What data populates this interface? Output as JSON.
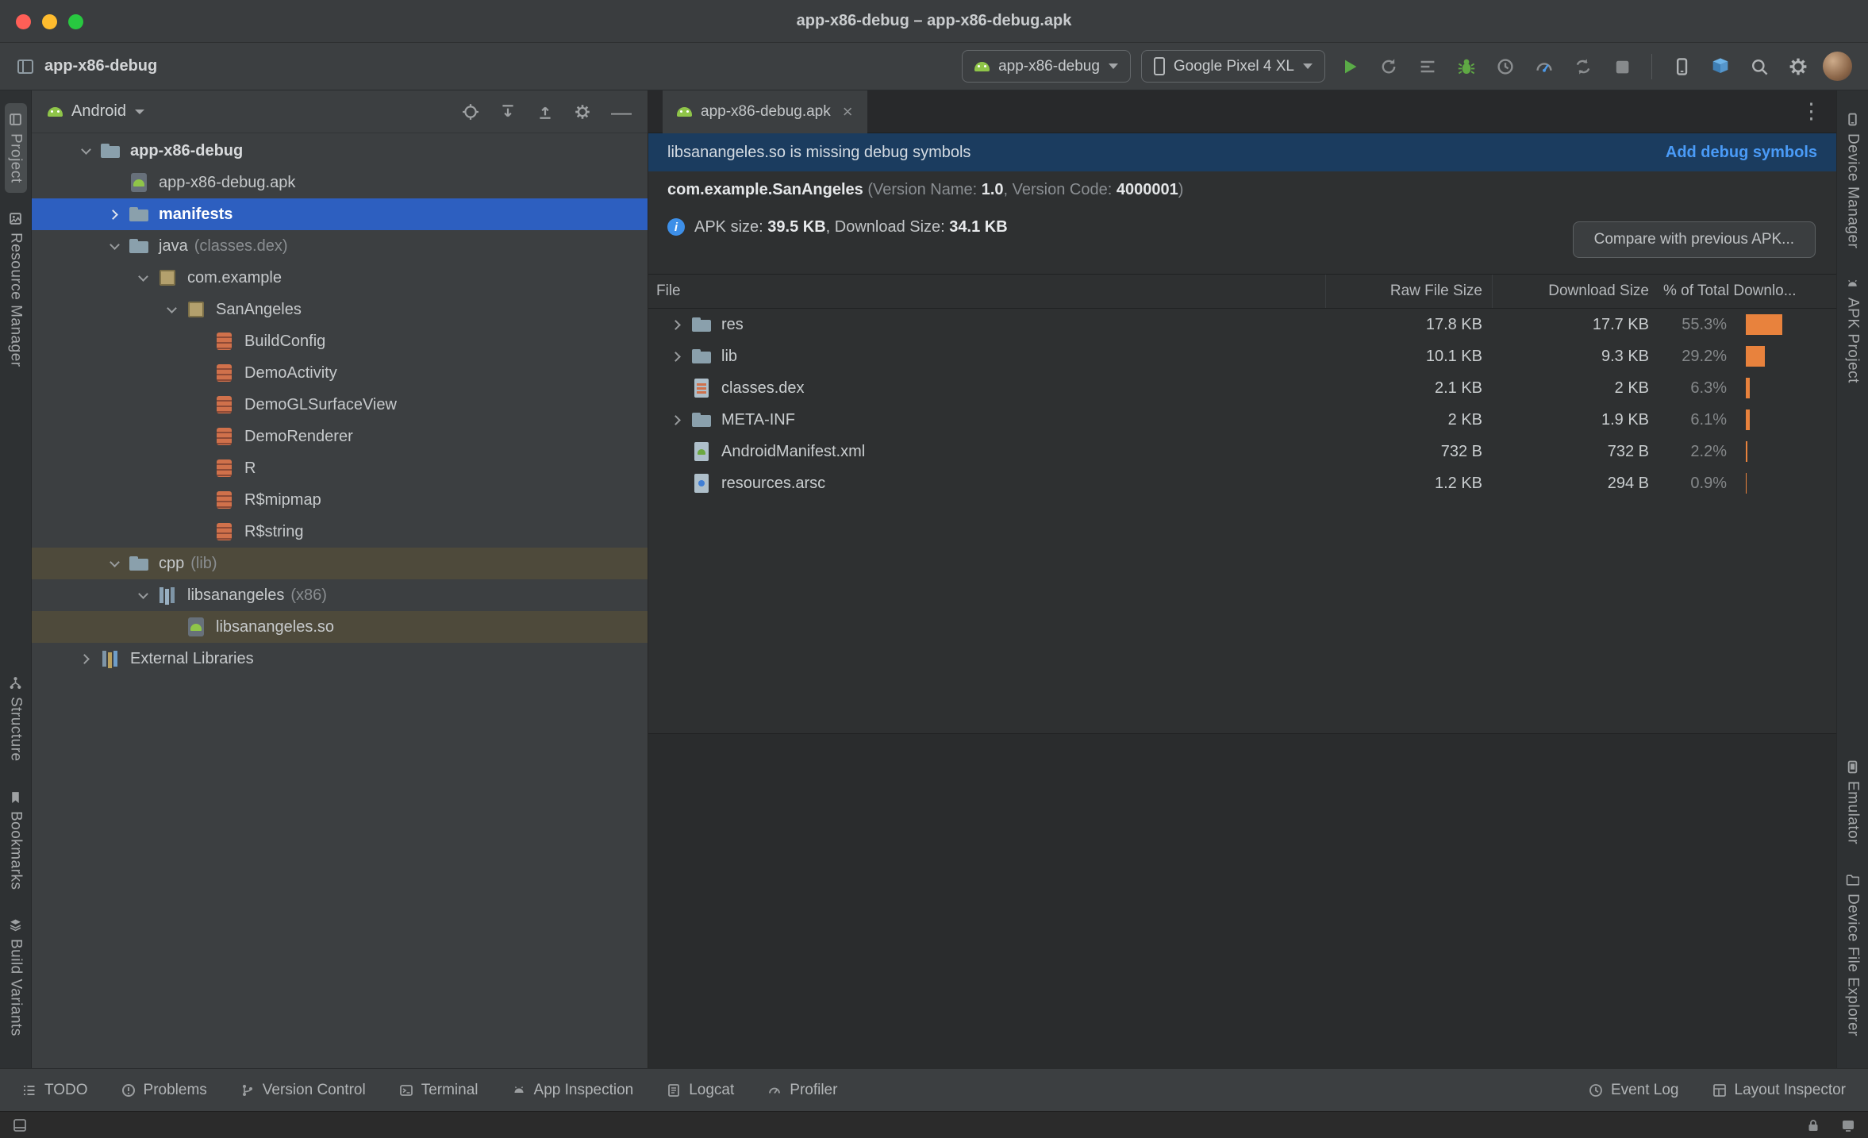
{
  "colors": {
    "selection_blue": "#2d5fc0",
    "tree_highlight_brown": "#4e4a3b",
    "bar_orange": "#e8823d",
    "link_blue": "#4a9bf7",
    "run_green": "#5aab47",
    "banner_blue": "#1b3c5f"
  },
  "window": {
    "title": "app-x86-debug – app-x86-debug.apk",
    "project_name": "app-x86-debug"
  },
  "toolbar": {
    "run_config": "app-x86-debug",
    "device": "Google Pixel 4 XL"
  },
  "left_stripe": {
    "items": [
      {
        "label": "Project"
      },
      {
        "label": "Resource Manager"
      },
      {
        "label": "Structure"
      },
      {
        "label": "Bookmarks"
      },
      {
        "label": "Build Variants"
      }
    ]
  },
  "right_stripe": {
    "items": [
      {
        "label": "Device Manager"
      },
      {
        "label": "APK Project"
      },
      {
        "label": "Emulator"
      },
      {
        "label": "Device File Explorer"
      }
    ]
  },
  "project_panel": {
    "view_selector": "Android",
    "tree": [
      {
        "label": "app-x86-debug",
        "annotation": ""
      },
      {
        "label": "app-x86-debug.apk",
        "annotation": ""
      },
      {
        "label": "manifests",
        "annotation": ""
      },
      {
        "label": "java",
        "annotation": "(classes.dex)"
      },
      {
        "label": "com.example",
        "annotation": ""
      },
      {
        "label": "SanAngeles",
        "annotation": ""
      },
      {
        "label": "BuildConfig",
        "annotation": ""
      },
      {
        "label": "DemoActivity",
        "annotation": ""
      },
      {
        "label": "DemoGLSurfaceView",
        "annotation": ""
      },
      {
        "label": "DemoRenderer",
        "annotation": ""
      },
      {
        "label": "R",
        "annotation": ""
      },
      {
        "label": "R$mipmap",
        "annotation": ""
      },
      {
        "label": "R$string",
        "annotation": ""
      },
      {
        "label": "cpp",
        "annotation": "(lib)"
      },
      {
        "label": "libsanangeles",
        "annotation": "(x86)"
      },
      {
        "label": "libsanangeles.so",
        "annotation": ""
      },
      {
        "label": "External Libraries",
        "annotation": ""
      }
    ]
  },
  "editor": {
    "tab_title": "app-x86-debug.apk",
    "banner": {
      "message": "libsanangeles.so is missing debug symbols",
      "action": "Add debug symbols"
    },
    "package_line": {
      "name": "com.example.SanAngeles",
      "version_name_label": " (Version Name: ",
      "version_name": "1.0",
      "version_code_label": ", Version Code: ",
      "version_code": "4000001",
      "closing": ")"
    },
    "size_line": {
      "apk_label": "APK size: ",
      "apk_size": "39.5 KB",
      "download_label": ", Download Size: ",
      "download_size": "34.1 KB"
    },
    "compare_button": "Compare with previous APK...",
    "table": {
      "columns": {
        "file": "File",
        "raw": "Raw File Size",
        "download": "Download Size",
        "pct": "% of Total Downlo..."
      },
      "rows": [
        {
          "file": "res",
          "raw": "17.8 KB",
          "download": "17.7 KB",
          "pct": "55.3%",
          "pct_value": 55.3
        },
        {
          "file": "lib",
          "raw": "10.1 KB",
          "download": "9.3 KB",
          "pct": "29.2%",
          "pct_value": 29.2
        },
        {
          "file": "classes.dex",
          "raw": "2.1 KB",
          "download": "2 KB",
          "pct": "6.3%",
          "pct_value": 6.3
        },
        {
          "file": "META-INF",
          "raw": "2 KB",
          "download": "1.9 KB",
          "pct": "6.1%",
          "pct_value": 6.1
        },
        {
          "file": "AndroidManifest.xml",
          "raw": "732 B",
          "download": "732 B",
          "pct": "2.2%",
          "pct_value": 2.2
        },
        {
          "file": "resources.arsc",
          "raw": "1.2 KB",
          "download": "294 B",
          "pct": "0.9%",
          "pct_value": 0.9
        }
      ]
    }
  },
  "status_bar": {
    "left": [
      {
        "label": "TODO"
      },
      {
        "label": "Problems"
      },
      {
        "label": "Version Control"
      },
      {
        "label": "Terminal"
      },
      {
        "label": "App Inspection"
      },
      {
        "label": "Logcat"
      },
      {
        "label": "Profiler"
      }
    ],
    "right": [
      {
        "label": "Event Log"
      },
      {
        "label": "Layout Inspector"
      }
    ]
  }
}
